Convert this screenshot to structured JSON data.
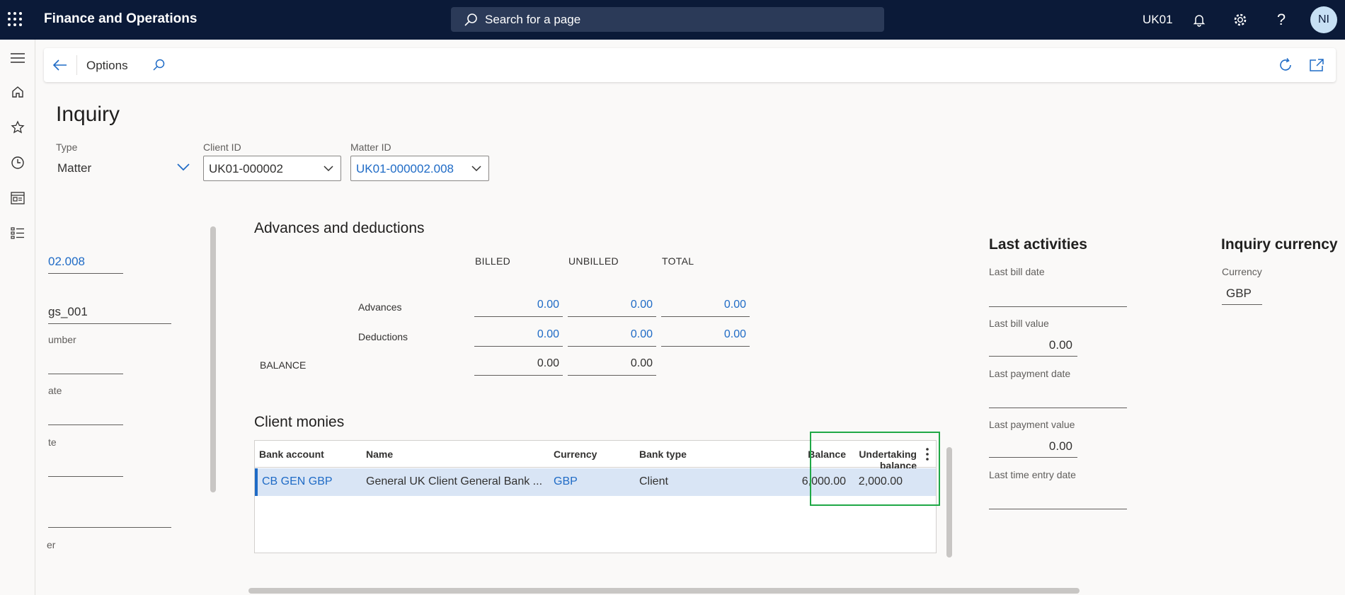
{
  "topbar": {
    "app_title": "Finance and Operations",
    "search_placeholder": "Search for a page",
    "company": "UK01",
    "avatar_initials": "NI"
  },
  "actionbar": {
    "options_label": "Options"
  },
  "page": {
    "title": "Inquiry"
  },
  "filters": {
    "type_label": "Type",
    "type_value": "Matter",
    "client_label": "Client ID",
    "client_value": "UK01-000002",
    "matter_label": "Matter ID",
    "matter_value": "UK01-000002.008"
  },
  "left_partial": {
    "value1": "02.008",
    "value2": "gs_001",
    "label3": "umber",
    "label4": "ate",
    "label5": "te",
    "label6": "er"
  },
  "advances": {
    "title": "Advances and deductions",
    "columns": [
      "BILLED",
      "UNBILLED",
      "TOTAL"
    ],
    "rows": [
      {
        "label": "Advances",
        "billed": "0.00",
        "unbilled": "0.00",
        "total": "0.00"
      },
      {
        "label": "Deductions",
        "billed": "0.00",
        "unbilled": "0.00",
        "total": "0.00"
      }
    ],
    "balance": {
      "label": "BALANCE",
      "billed": "0.00",
      "unbilled": "0.00"
    }
  },
  "client_monies": {
    "title": "Client monies",
    "columns": [
      "Bank account",
      "Name",
      "Currency",
      "Bank type",
      "Balance",
      "Undertaking balance"
    ],
    "rows": [
      {
        "bank_account": "CB GEN GBP",
        "name": "General UK Client General Bank ...",
        "currency": "GBP",
        "bank_type": "Client",
        "balance": "6,000.00",
        "undertaking_balance": "2,000.00"
      }
    ]
  },
  "last_activities": {
    "title": "Last activities",
    "last_bill_date_label": "Last bill date",
    "last_bill_date": "",
    "last_bill_value_label": "Last bill value",
    "last_bill_value": "0.00",
    "last_payment_date_label": "Last payment date",
    "last_payment_date": "",
    "last_payment_value_label": "Last payment value",
    "last_payment_value": "0.00",
    "last_time_entry_label": "Last time entry date",
    "last_time_entry": ""
  },
  "inquiry_currency": {
    "title": "Inquiry currency",
    "currency_label": "Currency",
    "currency_value": "GBP"
  },
  "colors": {
    "topbar": "#0b1a38",
    "link": "#1f6bc6",
    "highlight": "#1fa846",
    "selected_row": "#d9e5f5"
  }
}
